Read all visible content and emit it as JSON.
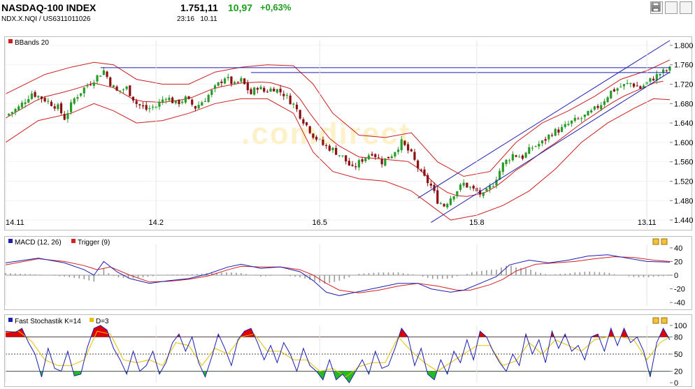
{
  "header": {
    "title": "NASDAQ-100 INDEX",
    "subtitle": "NDX.X.NQI  /  US6311011026",
    "price": "1.751,11",
    "change": "10,97",
    "change_pct": "+0,63%",
    "time": "23:16",
    "date": "10.11"
  },
  "icons": [
    "bar-chart-icon",
    "table-icon",
    "print-icon"
  ],
  "watermark": ".comdirect",
  "colors": {
    "candle_up": "#2a9b2a",
    "candle_down": "#8a1111",
    "bbands": "#cc1f1f",
    "trendline": "#1c1fb0",
    "macd": "#1c1fb0",
    "trigger": "#d22222",
    "stoch_k": "#1c1fb0",
    "stoch_d": "#e8c000",
    "stoch_high_fill": "#e00000",
    "stoch_low_fill": "#22bb22",
    "histogram": "#9a9a9a"
  },
  "chart_data": [
    {
      "type": "candlestick",
      "legend": "BBands 20",
      "x_ticks": [
        "14.11",
        "14.2",
        "16.5",
        "15.8",
        "13.11"
      ],
      "y_ticks": [
        "1.800",
        "1.760",
        "1.720",
        "1.680",
        "1.640",
        "1.600",
        "1.560",
        "1.520",
        "1.480",
        "1.440"
      ],
      "ylim": [
        1430,
        1810
      ],
      "close_path": [
        [
          0,
          1655
        ],
        [
          4,
          1672
        ],
        [
          8,
          1702
        ],
        [
          12,
          1688
        ],
        [
          16,
          1672
        ],
        [
          18,
          1650
        ],
        [
          21,
          1690
        ],
        [
          24,
          1712
        ],
        [
          27,
          1730
        ],
        [
          30,
          1748
        ],
        [
          32,
          1722
        ],
        [
          34,
          1705
        ],
        [
          37,
          1712
        ],
        [
          40,
          1680
        ],
        [
          43,
          1668
        ],
        [
          46,
          1675
        ],
        [
          49,
          1695
        ],
        [
          52,
          1680
        ],
        [
          55,
          1690
        ],
        [
          58,
          1672
        ],
        [
          61,
          1690
        ],
        [
          64,
          1712
        ],
        [
          67,
          1735
        ],
        [
          70,
          1718
        ],
        [
          72,
          1728
        ],
        [
          75,
          1700
        ],
        [
          77,
          1715
        ],
        [
          79,
          1705
        ],
        [
          82,
          1712
        ],
        [
          85,
          1700
        ],
        [
          88,
          1678
        ],
        [
          91,
          1645
        ],
        [
          94,
          1615
        ],
        [
          97,
          1595
        ],
        [
          100,
          1585
        ],
        [
          103,
          1570
        ],
        [
          106,
          1545
        ],
        [
          109,
          1565
        ],
        [
          112,
          1580
        ],
        [
          115,
          1560
        ],
        [
          118,
          1575
        ],
        [
          121,
          1600
        ],
        [
          124,
          1575
        ],
        [
          127,
          1535
        ],
        [
          130,
          1510
        ],
        [
          132,
          1480
        ],
        [
          134,
          1470
        ],
        [
          137,
          1495
        ],
        [
          140,
          1515
        ],
        [
          143,
          1502
        ],
        [
          146,
          1490
        ],
        [
          149,
          1515
        ],
        [
          152,
          1555
        ],
        [
          155,
          1575
        ],
        [
          158,
          1570
        ],
        [
          161,
          1590
        ],
        [
          164,
          1600
        ],
        [
          167,
          1620
        ],
        [
          170,
          1628
        ],
        [
          173,
          1642
        ],
        [
          176,
          1650
        ],
        [
          179,
          1662
        ],
        [
          182,
          1680
        ],
        [
          185,
          1705
        ],
        [
          188,
          1715
        ],
        [
          191,
          1722
        ],
        [
          194,
          1712
        ],
        [
          197,
          1728
        ],
        [
          200,
          1742
        ],
        [
          203,
          1751
        ]
      ],
      "bb_upper": [
        [
          0,
          1700
        ],
        [
          12,
          1740
        ],
        [
          20,
          1755
        ],
        [
          27,
          1765
        ],
        [
          33,
          1760
        ],
        [
          40,
          1730
        ],
        [
          48,
          1720
        ],
        [
          56,
          1720
        ],
        [
          64,
          1745
        ],
        [
          72,
          1755
        ],
        [
          80,
          1760
        ],
        [
          88,
          1758
        ],
        [
          94,
          1720
        ],
        [
          100,
          1660
        ],
        [
          108,
          1615
        ],
        [
          116,
          1610
        ],
        [
          124,
          1620
        ],
        [
          132,
          1560
        ],
        [
          140,
          1530
        ],
        [
          148,
          1540
        ],
        [
          156,
          1600
        ],
        [
          164,
          1640
        ],
        [
          172,
          1665
        ],
        [
          180,
          1695
        ],
        [
          188,
          1730
        ],
        [
          196,
          1748
        ],
        [
          203,
          1770
        ]
      ],
      "bb_lower": [
        [
          0,
          1600
        ],
        [
          10,
          1645
        ],
        [
          20,
          1660
        ],
        [
          27,
          1680
        ],
        [
          33,
          1665
        ],
        [
          40,
          1640
        ],
        [
          48,
          1645
        ],
        [
          56,
          1660
        ],
        [
          64,
          1680
        ],
        [
          72,
          1690
        ],
        [
          80,
          1690
        ],
        [
          88,
          1660
        ],
        [
          94,
          1580
        ],
        [
          100,
          1540
        ],
        [
          108,
          1525
        ],
        [
          116,
          1520
        ],
        [
          124,
          1500
        ],
        [
          130,
          1470
        ],
        [
          136,
          1440
        ],
        [
          144,
          1450
        ],
        [
          152,
          1470
        ],
        [
          160,
          1500
        ],
        [
          168,
          1545
        ],
        [
          176,
          1600
        ],
        [
          184,
          1640
        ],
        [
          192,
          1670
        ],
        [
          198,
          1690
        ],
        [
          203,
          1688
        ]
      ],
      "trendlines": [
        {
          "from": [
            29,
            1754
          ],
          "to": [
            203,
            1754
          ]
        },
        {
          "from": [
            75,
            1744
          ],
          "to": [
            203,
            1744
          ]
        },
        {
          "from": [
            126,
            1485
          ],
          "to": [
            203,
            1810
          ]
        },
        {
          "from": [
            130,
            1435
          ],
          "to": [
            203,
            1745
          ]
        }
      ]
    },
    {
      "type": "line",
      "legend": [
        "MACD (12, 26)",
        "Trigger (9)"
      ],
      "y_ticks": [
        "40",
        "20",
        "0",
        "-20",
        "-40"
      ],
      "ylim": [
        -45,
        45
      ],
      "macd": [
        [
          0,
          18
        ],
        [
          10,
          25
        ],
        [
          18,
          18
        ],
        [
          24,
          8
        ],
        [
          27,
          0
        ],
        [
          30,
          20
        ],
        [
          34,
          5
        ],
        [
          38,
          -5
        ],
        [
          44,
          -12
        ],
        [
          50,
          -8
        ],
        [
          56,
          -5
        ],
        [
          62,
          2
        ],
        [
          68,
          12
        ],
        [
          72,
          16
        ],
        [
          78,
          10
        ],
        [
          84,
          12
        ],
        [
          90,
          5
        ],
        [
          94,
          -8
        ],
        [
          98,
          -25
        ],
        [
          102,
          -30
        ],
        [
          108,
          -24
        ],
        [
          114,
          -18
        ],
        [
          120,
          -12
        ],
        [
          126,
          -12
        ],
        [
          130,
          -20
        ],
        [
          136,
          -25
        ],
        [
          140,
          -22
        ],
        [
          146,
          -10
        ],
        [
          150,
          -2
        ],
        [
          154,
          15
        ],
        [
          160,
          22
        ],
        [
          166,
          18
        ],
        [
          172,
          22
        ],
        [
          178,
          28
        ],
        [
          184,
          30
        ],
        [
          190,
          25
        ],
        [
          196,
          20
        ],
        [
          203,
          19
        ]
      ],
      "trigger": [
        [
          0,
          15
        ],
        [
          10,
          24
        ],
        [
          18,
          20
        ],
        [
          24,
          14
        ],
        [
          28,
          8
        ],
        [
          32,
          12
        ],
        [
          38,
          0
        ],
        [
          44,
          -10
        ],
        [
          50,
          -9
        ],
        [
          56,
          -6
        ],
        [
          62,
          -1
        ],
        [
          68,
          8
        ],
        [
          72,
          13
        ],
        [
          78,
          12
        ],
        [
          84,
          12
        ],
        [
          90,
          8
        ],
        [
          94,
          0
        ],
        [
          98,
          -12
        ],
        [
          102,
          -22
        ],
        [
          108,
          -26
        ],
        [
          114,
          -22
        ],
        [
          120,
          -16
        ],
        [
          126,
          -12
        ],
        [
          132,
          -16
        ],
        [
          138,
          -22
        ],
        [
          142,
          -22
        ],
        [
          148,
          -14
        ],
        [
          152,
          -6
        ],
        [
          156,
          6
        ],
        [
          162,
          16
        ],
        [
          168,
          18
        ],
        [
          174,
          20
        ],
        [
          180,
          24
        ],
        [
          186,
          27
        ],
        [
          192,
          26
        ],
        [
          198,
          22
        ],
        [
          203,
          20
        ]
      ]
    },
    {
      "type": "line",
      "legend": [
        "Fast Stochastik K=14",
        "D=3"
      ],
      "y_ticks": [
        "100",
        "80",
        "50",
        "20",
        "0"
      ],
      "ylim": [
        0,
        100
      ],
      "reference_lines": [
        80,
        50,
        20
      ],
      "k_line": [
        [
          0,
          90
        ],
        [
          3,
          88
        ],
        [
          5,
          95
        ],
        [
          7,
          70
        ],
        [
          9,
          50
        ],
        [
          11,
          10
        ],
        [
          13,
          60
        ],
        [
          15,
          25
        ],
        [
          17,
          20
        ],
        [
          19,
          55
        ],
        [
          21,
          12
        ],
        [
          23,
          15
        ],
        [
          25,
          62
        ],
        [
          27,
          95
        ],
        [
          29,
          100
        ],
        [
          31,
          92
        ],
        [
          33,
          60
        ],
        [
          35,
          40
        ],
        [
          37,
          15
        ],
        [
          39,
          55
        ],
        [
          41,
          20
        ],
        [
          43,
          30
        ],
        [
          45,
          55
        ],
        [
          47,
          15
        ],
        [
          49,
          35
        ],
        [
          51,
          70
        ],
        [
          53,
          85
        ],
        [
          55,
          55
        ],
        [
          57,
          80
        ],
        [
          59,
          35
        ],
        [
          61,
          10
        ],
        [
          63,
          45
        ],
        [
          65,
          85
        ],
        [
          67,
          60
        ],
        [
          69,
          30
        ],
        [
          71,
          75
        ],
        [
          73,
          90
        ],
        [
          75,
          95
        ],
        [
          77,
          70
        ],
        [
          79,
          40
        ],
        [
          81,
          65
        ],
        [
          83,
          35
        ],
        [
          85,
          70
        ],
        [
          87,
          50
        ],
        [
          89,
          20
        ],
        [
          91,
          60
        ],
        [
          93,
          30
        ],
        [
          95,
          20
        ],
        [
          97,
          5
        ],
        [
          99,
          40
        ],
        [
          101,
          5
        ],
        [
          103,
          15
        ],
        [
          105,
          0
        ],
        [
          107,
          20
        ],
        [
          109,
          40
        ],
        [
          111,
          15
        ],
        [
          113,
          55
        ],
        [
          115,
          25
        ],
        [
          117,
          30
        ],
        [
          119,
          60
        ],
        [
          121,
          95
        ],
        [
          123,
          80
        ],
        [
          125,
          30
        ],
        [
          127,
          60
        ],
        [
          129,
          15
        ],
        [
          131,
          5
        ],
        [
          133,
          40
        ],
        [
          135,
          15
        ],
        [
          137,
          55
        ],
        [
          139,
          35
        ],
        [
          141,
          75
        ],
        [
          143,
          40
        ],
        [
          145,
          90
        ],
        [
          147,
          80
        ],
        [
          149,
          55
        ],
        [
          151,
          35
        ],
        [
          153,
          20
        ],
        [
          155,
          50
        ],
        [
          157,
          30
        ],
        [
          159,
          85
        ],
        [
          161,
          50
        ],
        [
          163,
          75
        ],
        [
          165,
          35
        ],
        [
          167,
          90
        ],
        [
          169,
          60
        ],
        [
          171,
          85
        ],
        [
          173,
          55
        ],
        [
          175,
          65
        ],
        [
          177,
          40
        ],
        [
          179,
          80
        ],
        [
          181,
          85
        ],
        [
          183,
          55
        ],
        [
          185,
          95
        ],
        [
          187,
          65
        ],
        [
          189,
          95
        ],
        [
          191,
          70
        ],
        [
          193,
          80
        ],
        [
          195,
          55
        ],
        [
          197,
          10
        ],
        [
          199,
          70
        ],
        [
          201,
          95
        ],
        [
          203,
          75
        ]
      ],
      "d_line": [
        [
          0,
          88
        ],
        [
          4,
          90
        ],
        [
          8,
          72
        ],
        [
          12,
          40
        ],
        [
          16,
          30
        ],
        [
          20,
          30
        ],
        [
          24,
          40
        ],
        [
          28,
          90
        ],
        [
          32,
          85
        ],
        [
          36,
          40
        ],
        [
          40,
          35
        ],
        [
          44,
          40
        ],
        [
          48,
          30
        ],
        [
          52,
          70
        ],
        [
          56,
          65
        ],
        [
          60,
          30
        ],
        [
          64,
          60
        ],
        [
          68,
          50
        ],
        [
          72,
          80
        ],
        [
          76,
          85
        ],
        [
          80,
          55
        ],
        [
          84,
          55
        ],
        [
          88,
          40
        ],
        [
          92,
          40
        ],
        [
          96,
          20
        ],
        [
          100,
          25
        ],
        [
          104,
          10
        ],
        [
          108,
          28
        ],
        [
          112,
          35
        ],
        [
          116,
          35
        ],
        [
          120,
          80
        ],
        [
          124,
          55
        ],
        [
          128,
          35
        ],
        [
          132,
          20
        ],
        [
          136,
          35
        ],
        [
          140,
          50
        ],
        [
          144,
          65
        ],
        [
          148,
          65
        ],
        [
          152,
          30
        ],
        [
          156,
          38
        ],
        [
          160,
          70
        ],
        [
          164,
          50
        ],
        [
          168,
          75
        ],
        [
          172,
          65
        ],
        [
          176,
          55
        ],
        [
          180,
          75
        ],
        [
          184,
          80
        ],
        [
          188,
          80
        ],
        [
          192,
          75
        ],
        [
          196,
          40
        ],
        [
          200,
          70
        ],
        [
          203,
          80
        ]
      ]
    }
  ]
}
